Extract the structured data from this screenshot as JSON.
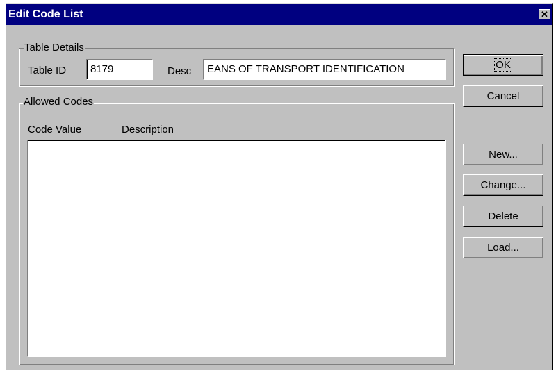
{
  "window": {
    "title": "Edit Code List",
    "close_glyph": "✕"
  },
  "table_details": {
    "group_label": "Table Details",
    "table_id_label": "Table ID",
    "table_id_value": "8179",
    "desc_label": "Desc",
    "desc_value": "EANS OF TRANSPORT IDENTIFICATION"
  },
  "allowed_codes": {
    "group_label": "Allowed Codes",
    "columns": [
      "Code Value",
      "Description"
    ],
    "rows": []
  },
  "buttons": {
    "ok": "OK",
    "cancel": "Cancel",
    "new": "New...",
    "change": "Change...",
    "delete": "Delete",
    "load": "Load..."
  }
}
